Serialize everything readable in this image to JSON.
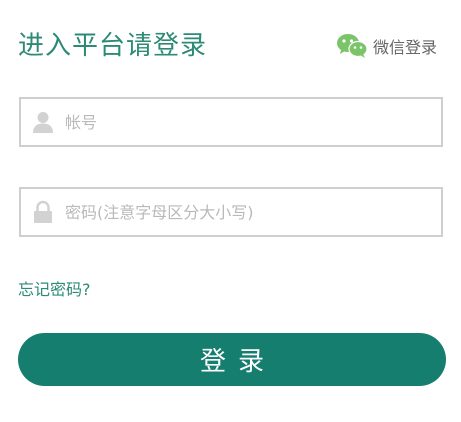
{
  "header": {
    "title": "进入平台请登录",
    "wechat_label": "微信登录",
    "wechat_icon": "wechat-icon"
  },
  "form": {
    "username": {
      "placeholder": "帐号",
      "value": "",
      "icon": "user-icon"
    },
    "password": {
      "placeholder": "密码(注意字母区分大小写)",
      "value": "",
      "icon": "lock-icon"
    },
    "forgot_label": "忘记密码?",
    "submit_label": "登录"
  },
  "colors": {
    "accent_text": "#2c8a76",
    "button": "#157e6f",
    "wechat_green": "#7cc46a",
    "border": "#cfcfcf"
  }
}
